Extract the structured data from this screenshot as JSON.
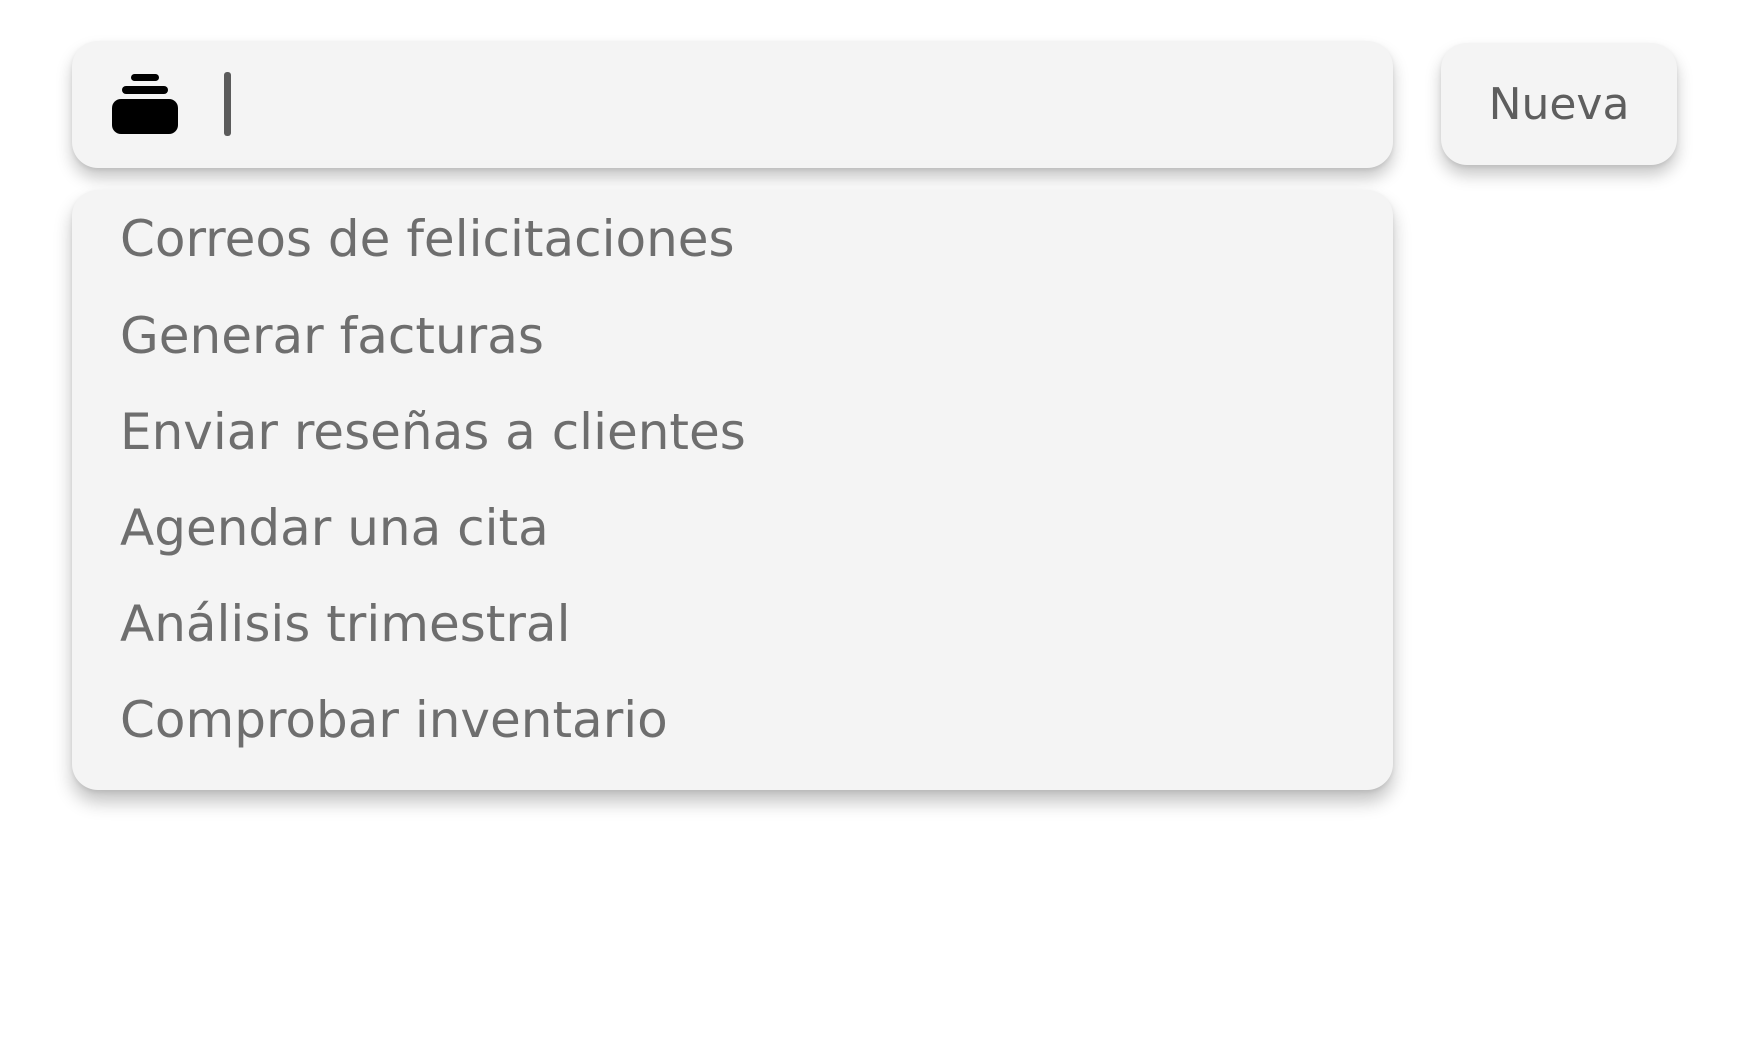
{
  "search": {
    "value": "",
    "placeholder": "",
    "icon": "stack-icon"
  },
  "new_button": {
    "label": "Nueva"
  },
  "dropdown": {
    "items": [
      {
        "label": "Correos de felicitaciones"
      },
      {
        "label": "Generar facturas"
      },
      {
        "label": "Enviar reseñas a clientes"
      },
      {
        "label": "Agendar una cita"
      },
      {
        "label": "Análisis trimestral"
      },
      {
        "label": "Comprobar inventario"
      }
    ]
  },
  "colors": {
    "surface": "#f4f4f4",
    "text": "#6e6e6e",
    "icon": "#000000",
    "background": "#ffffff"
  }
}
